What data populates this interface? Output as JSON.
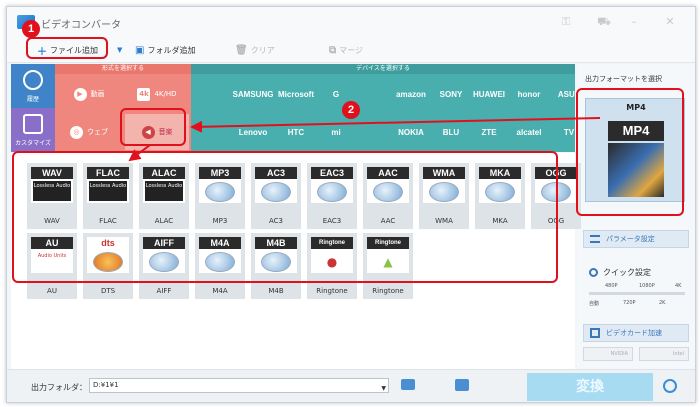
{
  "app": {
    "title": "ビデオコンバータ"
  },
  "toolbar": {
    "add_file": "ファイル追加",
    "add_folder": "フォルダ追加",
    "clear": "クリア",
    "merge": "マージ"
  },
  "nav": {
    "history": "履歴",
    "custom": "カスタマイズ"
  },
  "format_panel": {
    "header": "形式を選択する",
    "items": [
      {
        "label": "動画",
        "icon": "video-icon"
      },
      {
        "label": "4K/HD",
        "icon": "4k-icon"
      },
      {
        "label": "ウェブ",
        "icon": "web-icon"
      },
      {
        "label": "音楽",
        "icon": "music-icon"
      }
    ]
  },
  "device_panel": {
    "header": "デバイスを選択する",
    "row1": [
      "",
      "SAMSUNG",
      "Microsoft",
      "G",
      "",
      "amazon",
      "SONY",
      "HUAWEI",
      "honor",
      "ASUS"
    ],
    "row2": [
      "",
      "Lenovo",
      "HTC",
      "mi",
      "",
      "NOKIA",
      "BLU",
      "ZTE",
      "alcatel",
      "TV"
    ]
  },
  "grid": {
    "tiles": [
      {
        "badge": "WAV",
        "label": "WAV",
        "style": "lossless"
      },
      {
        "badge": "FLAC",
        "label": "FLAC",
        "style": "lossless"
      },
      {
        "badge": "ALAC",
        "label": "ALAC",
        "style": "lossless"
      },
      {
        "badge": "MP3",
        "label": "MP3",
        "style": "disc"
      },
      {
        "badge": "AC3",
        "label": "AC3",
        "style": "disc"
      },
      {
        "badge": "EAC3",
        "label": "EAC3",
        "style": "disc"
      },
      {
        "badge": "AAC",
        "label": "AAC",
        "style": "disc"
      },
      {
        "badge": "WMA",
        "label": "WMA",
        "style": "disc"
      },
      {
        "badge": "MKA",
        "label": "MKA",
        "style": "disc"
      },
      {
        "badge": "OGG",
        "label": "OGG",
        "style": "disc"
      },
      {
        "badge": "AU",
        "label": "AU",
        "style": "au"
      },
      {
        "badge": "dts",
        "label": "DTS",
        "style": "dts"
      },
      {
        "badge": "AIFF",
        "label": "AIFF",
        "style": "disc"
      },
      {
        "badge": "M4A",
        "label": "M4A",
        "style": "disc"
      },
      {
        "badge": "M4B",
        "label": "M4B",
        "style": "disc"
      },
      {
        "badge": "Ringtone",
        "label": "Ringtone",
        "style": "ring-apple"
      },
      {
        "badge": "Ringtone",
        "label": "Ringtone",
        "style": "ring-android"
      }
    ],
    "lossless_text": "Lossless Audio",
    "au_text": "Audio Units"
  },
  "right_panel": {
    "title": "出力フォーマットを選択",
    "card_label": "MP4",
    "card_badge": "MP4",
    "param_button": "パラメータ設定",
    "quick_label": "クイック設定",
    "ticks_top": [
      "480P",
      "1080P",
      "4K"
    ],
    "ticks_bottom": [
      "自動",
      "720P",
      "2K"
    ],
    "slider_value": 0,
    "gpu_button": "ビデオカード加速",
    "gpu_chips": [
      "NVIDIA",
      "Intel"
    ]
  },
  "bottom": {
    "output_label": "出力フォルダ：",
    "output_path": "D:¥1¥1",
    "convert": "変換"
  },
  "annotations": {
    "step1": "1",
    "step2": "2"
  },
  "colors": {
    "annotation_red": "#e0111d",
    "format_panel": "#f0877e",
    "device_panel": "#48aeae",
    "accent_blue": "#3a8ed8"
  }
}
